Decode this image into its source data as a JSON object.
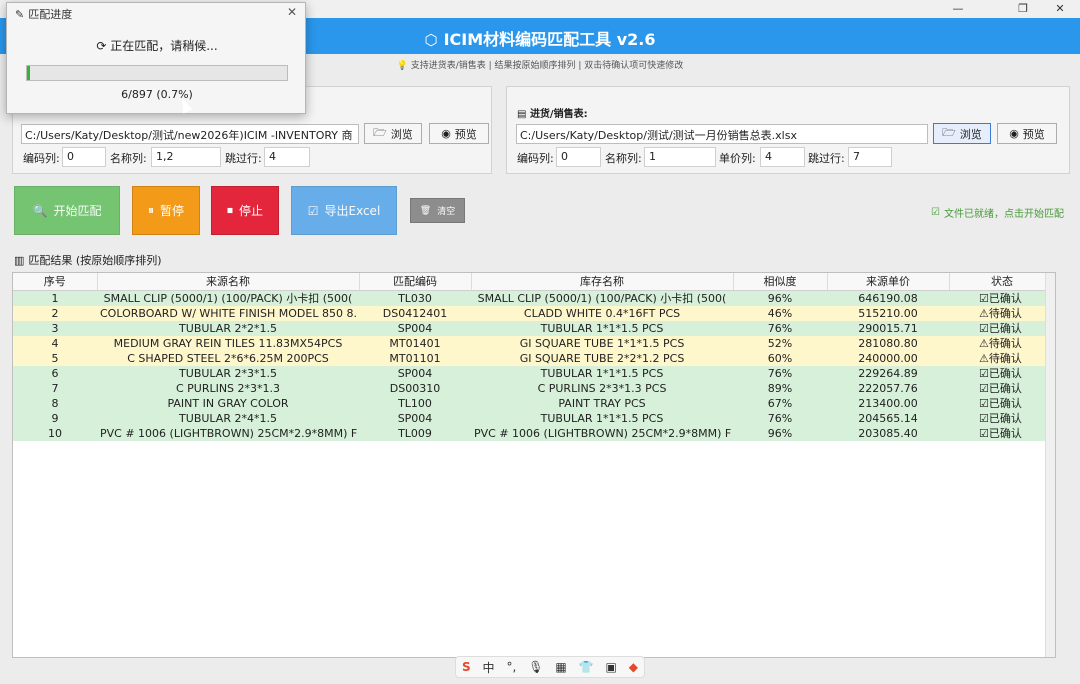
{
  "window": {
    "min_label": "—",
    "max_label": "❐",
    "close_label": "✕"
  },
  "banner": {
    "title": "ICIM材料编码匹配工具 v2.6",
    "subtip": "💡 支持进货表/销售表 | 结果按原始顺序排列 | 双击待确认项可快速修改"
  },
  "inventory": {
    "path": "C:/Users/Katy/Desktop/测试/new2026年)ICIM -INVENTORY 商",
    "browse_label": "浏览",
    "preview_label": "预览",
    "code_col_label": "编码列:",
    "code_col_value": "0",
    "name_col_label": "名称列:",
    "name_col_value": "1,2",
    "skip_label": "跳过行:",
    "skip_value": "4"
  },
  "sales": {
    "label": "进货/销售表:",
    "path": "C:/Users/Katy/Desktop/测试/测试一月份销售总表.xlsx",
    "browse_label": "浏览",
    "preview_label": "预览",
    "code_col_label": "编码列:",
    "code_col_value": "0",
    "name_col_label": "名称列:",
    "name_col_value": "1",
    "price_col_label": "单价列:",
    "price_col_value": "4",
    "skip_label": "跳过行:",
    "skip_value": "7"
  },
  "actions": {
    "start": "开始匹配",
    "pause": "暂停",
    "stop": "停止",
    "export": "导出Excel",
    "clear": "清空",
    "ready_note": "文件已就绪，点击开始匹配"
  },
  "results": {
    "title": "匹配结果 (按原始顺序排列)",
    "columns": [
      "序号",
      "来源名称",
      "匹配编码",
      "库存名称",
      "相似度",
      "来源单价",
      "状态"
    ],
    "rows": [
      {
        "no": "1",
        "src": "SMALL CLIP (5000/1) (100/PACK)  小卡扣  (500(",
        "code": "TL030",
        "inv": "SMALL CLIP (5000/1) (100/PACK)  小卡扣  (500(",
        "sim": "96%",
        "price": "646190.08",
        "status": "已确认",
        "state": "ok"
      },
      {
        "no": "2",
        "src": "COLORBOARD W/ WHITE FINISH MODEL 850 8.",
        "code": "DS0412401",
        "inv": "CLADD WHITE 0.4*16FT PCS",
        "sim": "46%",
        "price": "515210.00",
        "status": "待确认",
        "state": "wait"
      },
      {
        "no": "3",
        "src": "TUBULAR 2*2*1.5",
        "code": "SP004",
        "inv": "TUBULAR 1*1*1.5 PCS",
        "sim": "76%",
        "price": "290015.71",
        "status": "已确认",
        "state": "ok"
      },
      {
        "no": "4",
        "src": "MEDIUM GRAY REIN TILES 11.83MX54PCS",
        "code": "MT01401",
        "inv": "GI SQUARE TUBE 1*1*1.5 PCS",
        "sim": "52%",
        "price": "281080.80",
        "status": "待确认",
        "state": "wait"
      },
      {
        "no": "5",
        "src": "C SHAPED STEEL 2*6*6.25M 200PCS",
        "code": "MT01101",
        "inv": "GI SQUARE TUBE 2*2*1.2 PCS",
        "sim": "60%",
        "price": "240000.00",
        "status": "待确认",
        "state": "wait"
      },
      {
        "no": "6",
        "src": "TUBULAR 2*3*1.5",
        "code": "SP004",
        "inv": "TUBULAR 1*1*1.5 PCS",
        "sim": "76%",
        "price": "229264.89",
        "status": "已确认",
        "state": "ok"
      },
      {
        "no": "7",
        "src": "C PURLINS 2*3*1.3",
        "code": "DS00310",
        "inv": "C PURLINS 2*3*1.3 PCS",
        "sim": "89%",
        "price": "222057.76",
        "status": "已确认",
        "state": "ok"
      },
      {
        "no": "8",
        "src": "PAINT IN GRAY COLOR",
        "code": "TL100",
        "inv": "PAINT TRAY PCS",
        "sim": "67%",
        "price": "213400.00",
        "status": "已确认",
        "state": "ok"
      },
      {
        "no": "9",
        "src": "TUBULAR 2*4*1.5",
        "code": "SP004",
        "inv": "TUBULAR 1*1*1.5 PCS",
        "sim": "76%",
        "price": "204565.14",
        "status": "已确认",
        "state": "ok"
      },
      {
        "no": "10",
        "src": "PVC # 1006 (LIGHTBROWN) 25CM*2.9*8MM)  F",
        "code": "TL009",
        "inv": "PVC # 1006 (LIGHTBROWN) 25CM*2.9*8MM)  F",
        "sim": "96%",
        "price": "203085.40",
        "status": "已确认",
        "state": "ok"
      }
    ]
  },
  "progress": {
    "title": "匹配进度",
    "message": "正在匹配，请稍候...",
    "count_text": "6/897 (0.7%)",
    "fraction": 0.007
  },
  "taskbar": {
    "ime_mode": "中"
  }
}
